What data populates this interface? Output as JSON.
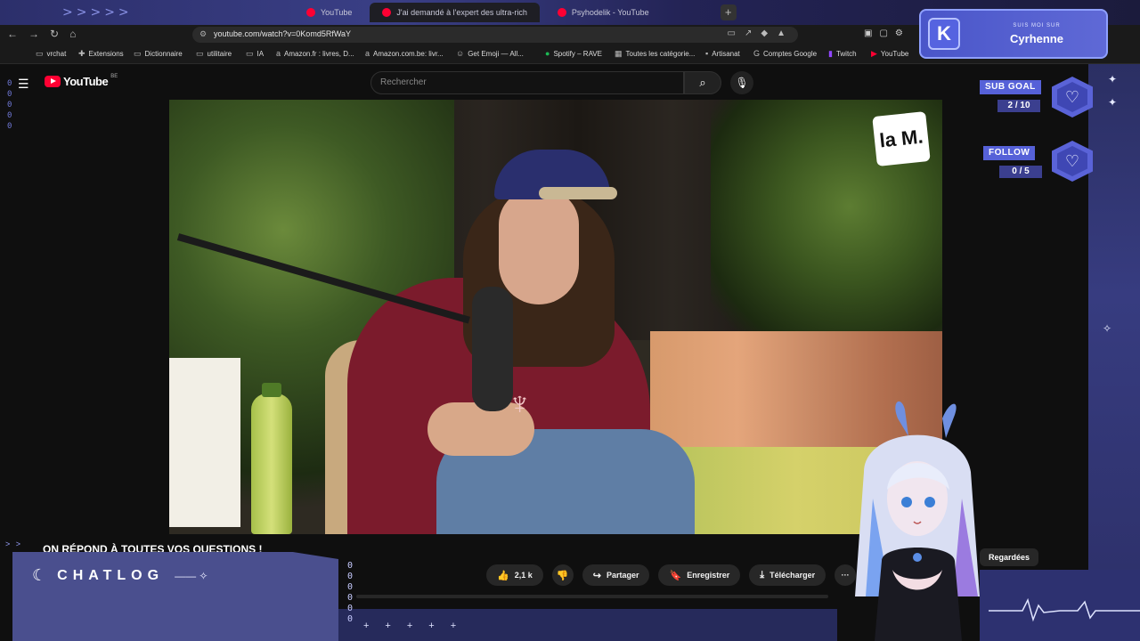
{
  "browser": {
    "tabs": [
      {
        "label": "YouTube",
        "active": false
      },
      {
        "label": "J'ai demandé à l'expert des ultra-rich",
        "active": true
      },
      {
        "label": "Psyhodelik - YouTube",
        "active": false
      }
    ],
    "new_tab": "+",
    "url": "youtube.com/watch?v=0Komd5RfWaY",
    "bookmarks": [
      {
        "label": "vrchat",
        "icon": "folder-icon"
      },
      {
        "label": "Extensions",
        "icon": "puzzle-icon"
      },
      {
        "label": "Dictionnaire",
        "icon": "folder-icon"
      },
      {
        "label": "utilitaire",
        "icon": "folder-icon"
      },
      {
        "label": "IA",
        "icon": "folder-icon"
      },
      {
        "label": "Amazon.fr : livres, D...",
        "icon": "amazon-icon"
      },
      {
        "label": "Amazon.com.be: livr...",
        "icon": "amazon-icon"
      },
      {
        "label": "Get Emoji — All...",
        "icon": "emoji-icon"
      },
      {
        "label": "Spotify – RAVE",
        "icon": "spotify-icon"
      },
      {
        "label": "Toutes les catégorie...",
        "icon": "grid-icon"
      },
      {
        "label": "Artisanat",
        "icon": "bookmark-icon"
      },
      {
        "label": "Comptes Google",
        "icon": "google-icon"
      },
      {
        "label": "Twitch",
        "icon": "twitch-icon"
      },
      {
        "label": "YouTube",
        "icon": "youtube-icon"
      }
    ]
  },
  "youtube": {
    "logo_text": "YouTube",
    "region": "BE",
    "search_placeholder": "Rechercher",
    "video_title": "ON RÉPOND À TOUTES VOS QUESTIONS !",
    "channel_logo": "la M.",
    "actions": {
      "likes": "2,1 k",
      "share": "Partager",
      "save": "Enregistrer",
      "download": "Télécharger",
      "more": "···"
    },
    "filter_chip": "Regardées"
  },
  "overlay": {
    "follow_card": {
      "sub": "SUIS MOI SUR",
      "name": "Cyrhenne",
      "badge": "K"
    },
    "sub_goal": {
      "label": "SUB GOAL",
      "value": "2 / 10"
    },
    "follow_goal": {
      "label": "FOLLOW",
      "value": "0 / 5"
    },
    "chatlog": {
      "title": "CHATLOG"
    },
    "accent": "#5661d8"
  }
}
